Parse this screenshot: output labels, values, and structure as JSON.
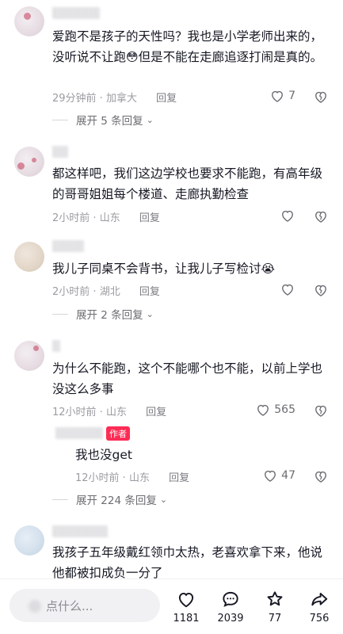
{
  "comments": [
    {
      "text_before_emoji": "爱跑不是孩子的天性吗？我也是小学老师出来的，没听说不让跑",
      "emoji": "😳",
      "text_after_emoji": "但是不能在走廊追逐打闹是真的。",
      "time": "29分钟前",
      "location": "加拿大",
      "reply_label": "回复",
      "likes": "7",
      "expand_label": "展开 5 条回复"
    },
    {
      "text": "都这样吧，我们这边学校也要求不能跑，有高年级的哥哥姐姐每个楼道、走廊执勤检查",
      "time": "2小时前",
      "location": "山东",
      "reply_label": "回复"
    },
    {
      "text_before_emoji": "我儿子同桌不会背书，让我儿子写检讨",
      "emoji": "😭",
      "time": "2小时前",
      "location": "湖北",
      "reply_label": "回复",
      "expand_label": "展开 2 条回复"
    },
    {
      "text": "为什么不能跑，这个不能哪个也不能，以前上学也没这么多事",
      "time": "12小时前",
      "location": "山东",
      "reply_label": "回复",
      "likes": "565"
    },
    {
      "text": "我孩子五年级戴红领巾太热，老喜欢拿下来，他说他都被扣成负一分了"
    }
  ],
  "author_reply": {
    "badge": "作者",
    "text": "我也没get",
    "time": "12小时前",
    "location": "山东",
    "reply_label": "回复",
    "likes": "47",
    "expand_label": "展开 224 条回复"
  },
  "bottom_bar": {
    "search_placeholder": "点什么...",
    "likes": "1181",
    "comments": "2039",
    "favorites": "77",
    "shares": "756"
  },
  "colors": {
    "accent": "#fe2c55",
    "text": "#161823",
    "meta": "#9b9ca1"
  }
}
